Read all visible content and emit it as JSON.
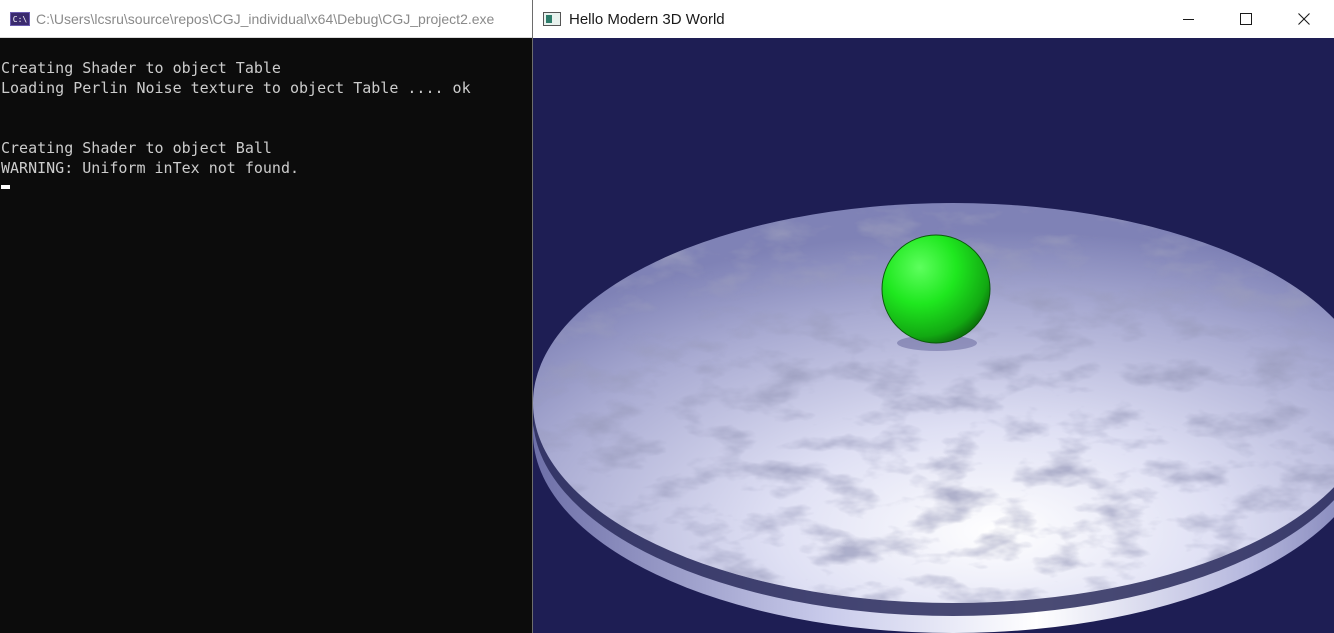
{
  "console": {
    "title": "C:\\Users\\lcsru\\source\\repos\\CGJ_individual\\x64\\Debug\\CGJ_project2.exe",
    "icon": "console-app-icon",
    "icon_text": "C:\\",
    "lines": [
      "Creating Shader to object Table",
      "Loading Perlin Noise texture to object Table .... ok",
      "",
      "",
      "Creating Shader to object Ball",
      "WARNING: Uniform inTex not found."
    ]
  },
  "gl_window": {
    "title": "Hello Modern 3D World",
    "icon": "app-window-icon",
    "buttons": {
      "minimize": "minimize-icon",
      "maximize": "maximize-icon",
      "close": "close-icon"
    },
    "scene": {
      "background_color": "#1e1e54",
      "table_color": "#c8cae8",
      "ball_color": "#1fe81f"
    }
  }
}
